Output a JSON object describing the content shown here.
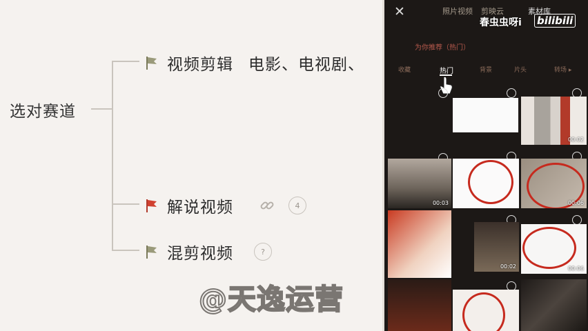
{
  "mindmap": {
    "root": "选对赛道",
    "branches": [
      {
        "label": "视频剪辑",
        "extra": "电影、电视剧、",
        "flag_color": "#8a8a6a"
      },
      {
        "label": "解说视频",
        "badge": "4",
        "flag_color": "#c0392b"
      },
      {
        "label": "混剪视频",
        "badge": "?",
        "flag_color": "#8a8a6a"
      }
    ]
  },
  "phone": {
    "close": "✕",
    "top_tabs": [
      "照片视频",
      "剪映云",
      "素材库"
    ],
    "channel_name": "春虫虫呀i",
    "logo": "bilibili",
    "subtitle": "为你推荐（热门）",
    "categories": [
      "收藏",
      "热门",
      "背景",
      "片头",
      "转场 ▸"
    ],
    "durations": [
      "00:02",
      "00:03",
      "00:06",
      "00:02",
      "00:06"
    ]
  },
  "watermark": "@天逸运营"
}
